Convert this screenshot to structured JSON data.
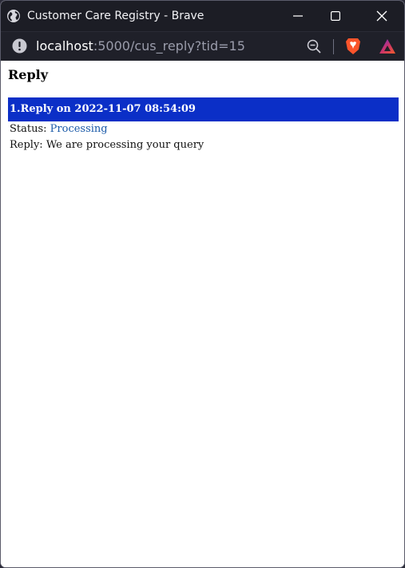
{
  "window": {
    "title": "Customer Care Registry - Brave",
    "icon": "globe-icon"
  },
  "address_bar": {
    "host": "localhost",
    "rest": ":5000/cus_reply?tid=15"
  },
  "page": {
    "heading": "Reply",
    "replies": [
      {
        "header": "1.Reply on 2022-11-07 08:54:09",
        "status_label": "Status: ",
        "status_value": "Processing",
        "reply_label": "Reply: ",
        "reply_text": "We are processing your query"
      }
    ]
  },
  "colors": {
    "titlebar": "#1c1d25",
    "reply_header_bg": "#0b2fc7",
    "status_link": "#1a5aa8",
    "brave_orange": "#fb542b"
  }
}
